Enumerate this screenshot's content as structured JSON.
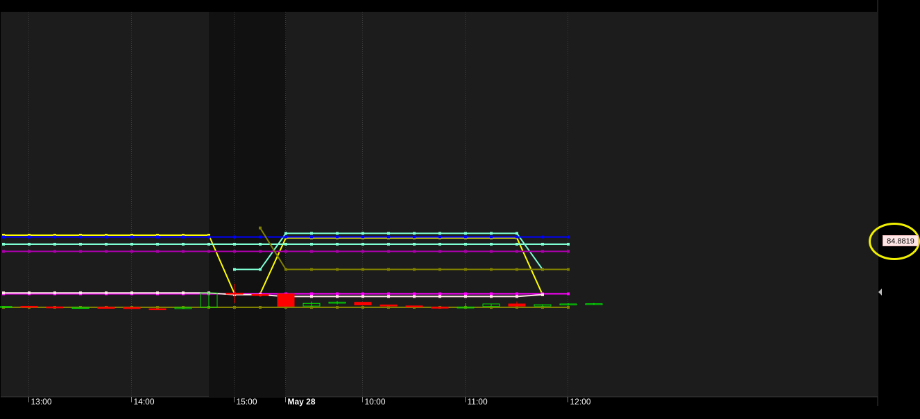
{
  "chart_data": {
    "type": "candlestick",
    "title": "",
    "x_ticks": [
      "13:00",
      "14:00",
      "15:00",
      "May 28",
      "10:00",
      "11:00",
      "12:00"
    ],
    "x_tick_bars": [
      1,
      5,
      9,
      11,
      14,
      18,
      22
    ],
    "y_scale": "unlabeled price axis (higher value = higher on chart)",
    "price_label": "84.8819",
    "candles": [
      {
        "o": 100,
        "h": 101.2,
        "l": 99.8,
        "c": 101.0
      },
      {
        "o": 101.2,
        "h": 101.3,
        "l": 100.0,
        "c": 100.2
      },
      {
        "o": 100.5,
        "h": 100.6,
        "l": 99.3,
        "c": 99.5
      },
      {
        "o": 99.3,
        "h": 100.8,
        "l": 98.8,
        "c": 100.0
      },
      {
        "o": 100.0,
        "h": 101.6,
        "l": 99.6,
        "c": 99.8
      },
      {
        "o": 99.8,
        "h": 99.9,
        "l": 98.4,
        "c": 98.6
      },
      {
        "o": 98.4,
        "h": 98.5,
        "l": 98.0,
        "c": 98.2
      },
      {
        "o": 98.6,
        "h": 100.2,
        "l": 98.4,
        "c": 100.0
      },
      {
        "o": 100.0,
        "h": 116.1,
        "l": 99.7,
        "c": 116.0
      },
      {
        "o": 115.8,
        "h": 126.2,
        "l": 104.6,
        "c": 114.6
      },
      {
        "o": 114.2,
        "h": 114.4,
        "l": 111.6,
        "c": 113.6
      },
      {
        "o": 114.8,
        "h": 114.9,
        "l": 101.0,
        "c": 101.2
      },
      {
        "o": 101.4,
        "h": 106.4,
        "l": 101.2,
        "c": 104.4
      },
      {
        "o": 104.8,
        "h": 107.0,
        "l": 103.2,
        "c": 105.8
      },
      {
        "o": 105.6,
        "h": 105.7,
        "l": 102.4,
        "c": 102.6
      },
      {
        "o": 102.6,
        "h": 102.7,
        "l": 101.4,
        "c": 101.8
      },
      {
        "o": 101.6,
        "h": 101.7,
        "l": 100.6,
        "c": 100.8
      },
      {
        "o": 100.2,
        "h": 101.0,
        "l": 98.4,
        "c": 99.4
      },
      {
        "o": 99.4,
        "h": 104.4,
        "l": 99.2,
        "c": 100.4
      },
      {
        "o": 101.0,
        "h": 104.0,
        "l": 100.8,
        "c": 103.8
      },
      {
        "o": 103.8,
        "h": 106.4,
        "l": 101.2,
        "c": 101.4
      },
      {
        "o": 101.4,
        "h": 103.4,
        "l": 101.2,
        "c": 103.0
      },
      {
        "o": 102.6,
        "h": 104.6,
        "l": 101.8,
        "c": 103.8
      },
      {
        "o": 103.8,
        "h": 104.8,
        "l": 102.8,
        "c": 104.0
      }
    ],
    "series": [
      {
        "color": "#ffff00",
        "values": [
          180,
          180,
          180,
          180,
          180,
          180,
          180,
          180,
          180,
          115,
          115,
          177,
          177,
          177,
          177,
          177,
          177,
          177,
          177,
          177,
          177,
          114,
          null,
          null
        ]
      },
      {
        "color": "#7fffd4",
        "values": [
          null,
          null,
          null,
          null,
          null,
          null,
          null,
          null,
          null,
          142,
          142,
          182,
          182,
          182,
          182,
          182,
          182,
          182,
          182,
          182,
          182,
          142,
          null,
          null
        ]
      },
      {
        "color": "#0000ff",
        "values": [
          178,
          178,
          178,
          178,
          178,
          178,
          178,
          178,
          178,
          178,
          178,
          178,
          178,
          178,
          178,
          178,
          178,
          178,
          178,
          178,
          178,
          178,
          178,
          null
        ]
      },
      {
        "color": "#7fffd4",
        "values": [
          170,
          170,
          170,
          170,
          170,
          170,
          170,
          170,
          170,
          170,
          170,
          170,
          170,
          170,
          170,
          170,
          170,
          170,
          170,
          170,
          170,
          170,
          170,
          null
        ]
      },
      {
        "color": "#aa00aa",
        "values": [
          162,
          162,
          162,
          162,
          162,
          162,
          162,
          162,
          162,
          162,
          162,
          162,
          162,
          162,
          162,
          162,
          162,
          162,
          162,
          162,
          162,
          162,
          162,
          null
        ]
      },
      {
        "color": "#808000",
        "values": [
          null,
          null,
          null,
          null,
          null,
          null,
          null,
          null,
          null,
          null,
          188,
          142,
          142,
          142,
          142,
          142,
          142,
          142,
          142,
          142,
          142,
          142,
          142,
          null
        ]
      },
      {
        "color": "#ff00ff",
        "values": [
          115,
          115,
          115,
          115,
          115,
          115,
          115,
          115,
          115,
          115,
          115,
          115,
          115,
          115,
          115,
          115,
          115,
          115,
          115,
          115,
          115,
          115,
          115,
          null
        ]
      },
      {
        "color": "#ffe6e6",
        "values": [
          116,
          116,
          116,
          116,
          116,
          116,
          116,
          116,
          116,
          114,
          114,
          112,
          112,
          112,
          112,
          112,
          112,
          112,
          112,
          112,
          112,
          114,
          null,
          null
        ]
      },
      {
        "color": "#808000",
        "values": [
          100,
          100,
          100,
          100,
          100,
          100,
          100,
          100,
          100,
          100,
          100,
          100,
          100,
          100,
          100,
          100,
          100,
          100,
          100,
          100,
          100,
          100,
          100,
          null
        ]
      }
    ]
  }
}
